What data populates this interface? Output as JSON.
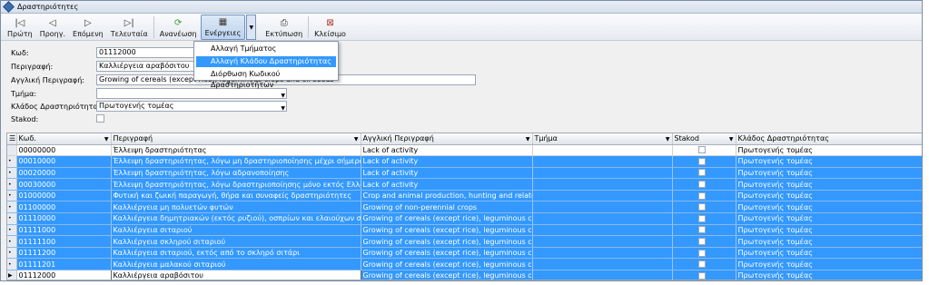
{
  "window": {
    "title": "Δραστηριότητες"
  },
  "toolbar": {
    "first": "Πρώτη",
    "prev": "Προηγ.",
    "next": "Επόμενη",
    "last": "Τελευταία",
    "refresh": "Ανανέωση",
    "actions": "Ενέργειες",
    "print": "Εκτύπωση",
    "close": "Κλείσιμο"
  },
  "menu": {
    "items": [
      "Αλλαγή Τμήματος",
      "Αλλαγή Κλάδου Δραστηριότητας",
      "Διόρθωση Κωδικού Δραστηριοτήτων"
    ],
    "highlighted_index": 1
  },
  "form": {
    "code_label": "Κωδ:",
    "code_value": "01112000",
    "desc_label": "Περιγραφή:",
    "desc_value": "Καλλιέργεια αραβόσιτου",
    "en_desc_label": "Αγγλική Περιγραφή:",
    "en_desc_value": "Growing of cereals (except rice), leguminous crops and oil seeds",
    "dept_label": "Τμήμα:",
    "dept_value": "",
    "sector_label": "Κλάδος Δραστηριότητας:",
    "sector_value": "Πρωτογενής τομέας",
    "stakod_label": "Stakod:"
  },
  "grid": {
    "columns": [
      "Κωδ.",
      "Περιγραφή",
      "Αγγλική Περιγραφή",
      "Τμήμα",
      "Stakod",
      "Κλάδος Δραστηριότητας"
    ],
    "rows": [
      {
        "code": "00000000",
        "desc": "Έλλειψη δραστηριότητας",
        "en": "Lack of activity",
        "dept": "",
        "sector": "Πρωτογενής τομέας",
        "selected": false
      },
      {
        "code": "00010000",
        "desc": "Έλλειψη δραστηριότητας, λόγω μη δραστηριοποίησης μέχρι σήμερα",
        "en": "Lack of activity",
        "dept": "",
        "sector": "Πρωτογενής τομέας",
        "selected": true
      },
      {
        "code": "00020000",
        "desc": "Έλλειψη δραστηριότητας, λόγω αδρανοποίησης",
        "en": "Lack of activity",
        "dept": "",
        "sector": "Πρωτογενής τομέας",
        "selected": true
      },
      {
        "code": "00030000",
        "desc": "Έλλειψη δραστηριότητας, λόγω δραστηριοποίησης μόνο εκτός Ελλάδας",
        "en": "Lack of activity",
        "dept": "",
        "sector": "Πρωτογενής τομέας",
        "selected": true
      },
      {
        "code": "01000000",
        "desc": "Φυτική και ζωική παραγωγή, θήρα και συναφείς δραστηριότητες",
        "en": "Crop and animal production, hunting and related ser",
        "dept": "",
        "sector": "Πρωτογενής τομέας",
        "selected": true
      },
      {
        "code": "01100000",
        "desc": "Καλλιέργεια μη πολυετών φυτών",
        "en": "Growing of non-perennial crops",
        "dept": "",
        "sector": "Πρωτογενής τομέας",
        "selected": true
      },
      {
        "code": "01110000",
        "desc": "Καλλιέργεια δημητριακών (εκτός ρυζιού), οσπρίων και ελαιούχων σπόρων",
        "en": "Growing of cereals (except rice), leguminous crops",
        "dept": "",
        "sector": "Πρωτογενής τομέας",
        "selected": true
      },
      {
        "code": "01111000",
        "desc": "Καλλιέργεια σιταριού",
        "en": "Growing of cereals (except rice), leguminous crops",
        "dept": "",
        "sector": "Πρωτογενής τομέας",
        "selected": true
      },
      {
        "code": "01111100",
        "desc": "Καλλιέργεια σκληρού σιταριού",
        "en": "Growing of cereals (except rice), leguminous crops",
        "dept": "",
        "sector": "Πρωτογενής τομέας",
        "selected": true
      },
      {
        "code": "01111200",
        "desc": "Καλλιέργεια σιταριού, εκτός από το σκληρό σιτάρι",
        "en": "Growing of cereals (except rice), leguminous crops",
        "dept": "",
        "sector": "Πρωτογενής τομέας",
        "selected": true
      },
      {
        "code": "01111201",
        "desc": "Καλλιέργεια μαλακού σιταριού",
        "en": "Growing of cereals (except rice), leguminous crops",
        "dept": "",
        "sector": "Πρωτογενής τομέας",
        "selected": true
      },
      {
        "code": "01112000",
        "desc": "Καλλιέργεια αραβόσιτου",
        "en": "Growing of cereals (except rice), leguminous crops",
        "dept": "",
        "sector": "Πρωτογενής τομέας",
        "selected": true,
        "current": true
      }
    ]
  },
  "colors": {
    "selection": "#3399ff",
    "menu_highlight": "#3399ff"
  }
}
